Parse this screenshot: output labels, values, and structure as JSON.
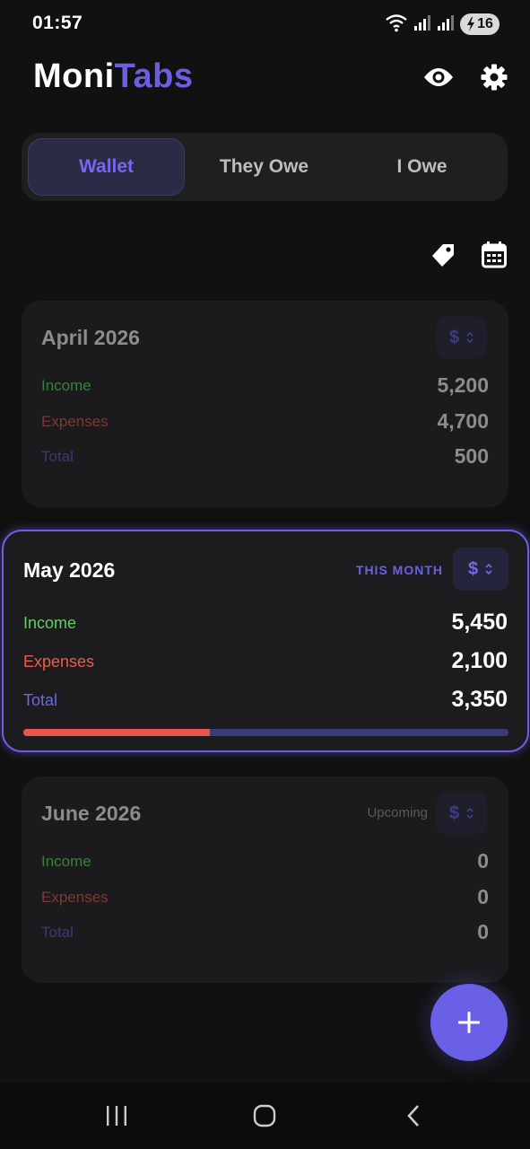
{
  "status": {
    "time": "01:57",
    "battery": "16"
  },
  "app": {
    "title_part1": "Moni",
    "title_part2": "Tabs"
  },
  "tabs": [
    {
      "label": "Wallet",
      "active": true
    },
    {
      "label": "They Owe",
      "active": false
    },
    {
      "label": "I Owe",
      "active": false
    }
  ],
  "colors": {
    "accent": "#6a60e8",
    "income": "#61cf61",
    "expenses": "#ef5a4d",
    "total": "#6c66e8",
    "background": "#111111"
  },
  "cards": [
    {
      "month": "April 2026",
      "currency": "$",
      "income_label": "Income",
      "income": "5,200",
      "expenses_label": "Expenses",
      "expenses": "4,700",
      "total_label": "Total",
      "total": "500"
    },
    {
      "month": "May 2026",
      "badge": "THIS MONTH",
      "currency": "$",
      "income_label": "Income",
      "income": "5,450",
      "expenses_label": "Expenses",
      "expenses": "2,100",
      "total_label": "Total",
      "total": "3,350",
      "expense_ratio": 0.385
    },
    {
      "month": "June 2026",
      "status": "Upcoming",
      "currency": "$",
      "income_label": "Income",
      "income": "0",
      "expenses_label": "Expenses",
      "expenses": "0",
      "total_label": "Total",
      "total": "0"
    }
  ],
  "fab": {
    "icon": "plus-icon"
  },
  "icons": [
    "wifi-icon",
    "signal-icon",
    "eye-icon",
    "gear-icon",
    "tag-icon",
    "calendar-icon",
    "recents-icon",
    "home-icon",
    "back-icon"
  ]
}
